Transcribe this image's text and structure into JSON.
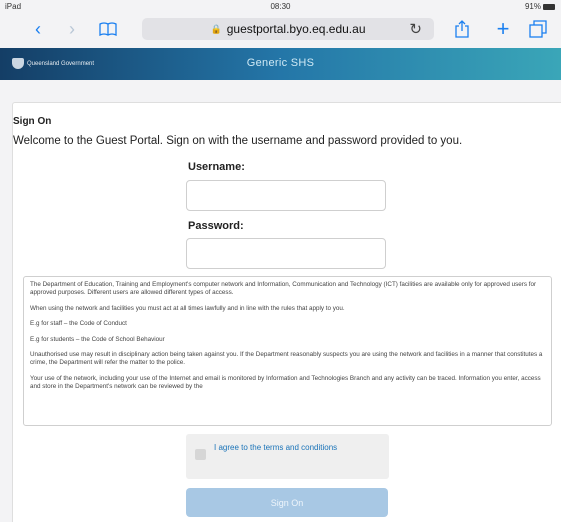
{
  "status_bar": {
    "carrier": "iPad",
    "time": "08:30",
    "battery": "91%"
  },
  "browser": {
    "url": "guestportal.byo.eq.edu.au",
    "icons": {
      "back": "chevron-left-icon",
      "forward": "chevron-right-icon",
      "bookmarks": "book-icon",
      "reload": "reload-icon",
      "share": "share-icon",
      "new_tab": "plus-icon",
      "tabs": "tabs-icon"
    },
    "back": "‹",
    "forward": "›",
    "bookmarks": "📖",
    "reload": "↻",
    "share": "⇧",
    "new_tab": "+",
    "tabs": "❐"
  },
  "header": {
    "org": "Queensland Government",
    "title": "Generic SHS"
  },
  "signon": {
    "title": "Sign On",
    "welcome": "Welcome to the Guest Portal. Sign on with the username and password provided to you.",
    "username_label": "Username:",
    "username_value": "",
    "password_label": "Password:",
    "password_value": ""
  },
  "terms": {
    "paragraphs": [
      "The Department of Education, Training and Employment's computer network and Information, Communication and Technology (ICT) facilities are available only for approved users for approved purposes. Different users are allowed different types of access.",
      "When using the network and facilities you must act at all times lawfully and in line with the rules that apply to you.",
      "E.g for staff – the Code of Conduct",
      "E.g for students – the Code of School Behaviour",
      "Unauthorised use may result in disciplinary action being taken against you. If the Department reasonably suspects you are using the network and facilities in a manner that constitutes a crime, the Department will refer the matter to the police.",
      "Your use of the network, including your use of the Internet and email is monitored by Information and Technologies Branch and any activity can be traced. Information you enter, access and store in the Department's network can be reviewed by the"
    ]
  },
  "agree": {
    "label": "I agree to the terms and conditions",
    "checked": false
  },
  "actions": {
    "sign_on": "Sign On"
  }
}
